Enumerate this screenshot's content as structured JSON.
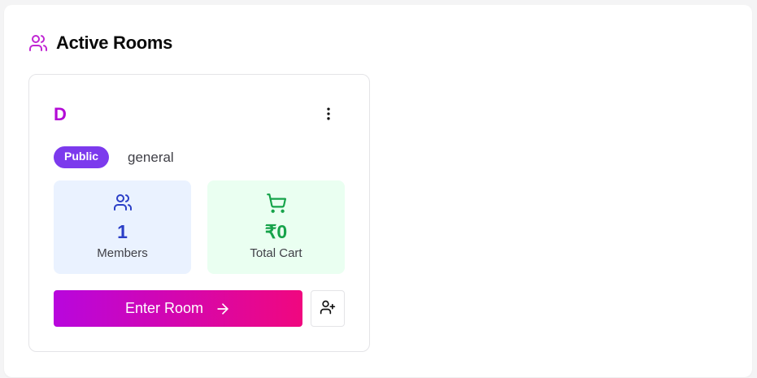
{
  "section": {
    "title": "Active Rooms",
    "icon": "users-icon"
  },
  "room": {
    "name": "D",
    "visibility": "Public",
    "category": "general",
    "menu_icon": "more-vertical-icon",
    "members": {
      "icon": "users-icon",
      "value": "1",
      "label": "Members"
    },
    "cart": {
      "icon": "shopping-cart-icon",
      "value": "₹0",
      "label": "Total Cart"
    },
    "enter_label": "Enter Room",
    "enter_icon": "arrow-right-icon",
    "invite_icon": "user-plus-icon"
  },
  "colors": {
    "room_name": "#b30ad6",
    "badge": "#7c3aed",
    "members_accent": "#2b3fc7",
    "cart_accent": "#16a34a",
    "button_gradient_start": "#b806dd",
    "button_gradient_end": "#f0077f"
  }
}
